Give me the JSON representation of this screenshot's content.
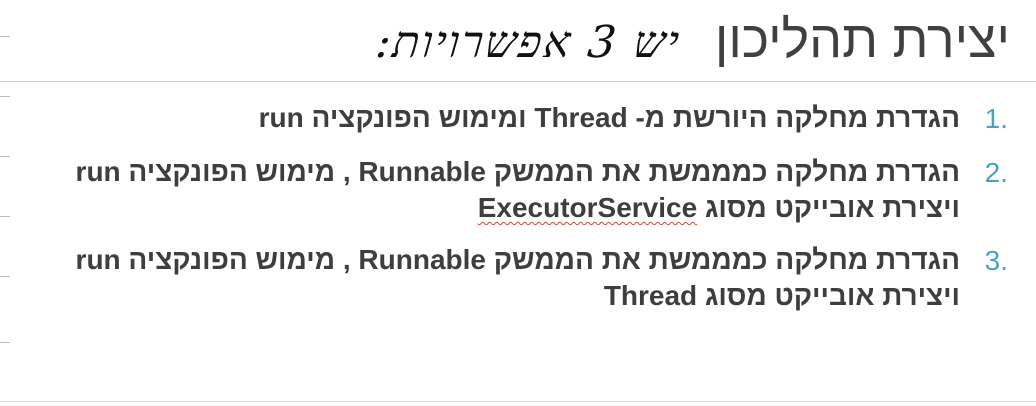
{
  "title": "יצירת תהליכון",
  "handwritten_note": "יש 3 אפשרויות:",
  "items": [
    {
      "number": "1.",
      "text": "הגדרת מחלקה היורשת מ- Thread ומימוש הפונקציה run"
    },
    {
      "number": "2.",
      "text": "הגדרת מחלקה כמממשת את הממשק Runnable , מימוש הפונקציה run ויצירת אובייקט מסוג ",
      "underlined": "ExecutorService"
    },
    {
      "number": "3.",
      "text": "הגדרת מחלקה כמממשת את הממשק Runnable , מימוש הפונקציה run ויצירת אובייקט מסוג Thread"
    }
  ],
  "colors": {
    "number": "#4aa1c9",
    "spellcheck": "#d0453f"
  }
}
